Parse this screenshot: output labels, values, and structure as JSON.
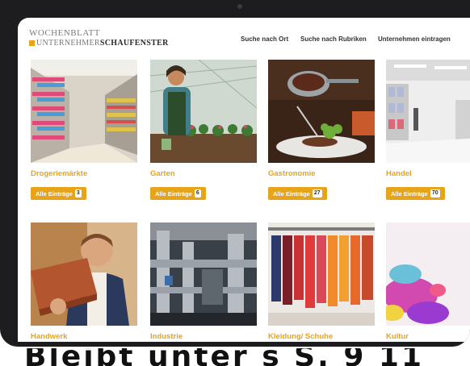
{
  "header": {
    "logo_line1": "WOCHENBLATT",
    "logo_line2_a": "UNTERNEHMER",
    "logo_line2_b": "SCHAUFENSTER",
    "nav": [
      "Suche nach Ort",
      "Suche nach Rubriken",
      "Unternehmen eintragen"
    ]
  },
  "categories": [
    {
      "label": "Drogeriemärkte",
      "button": "Alle Einträge",
      "count": "3"
    },
    {
      "label": "Garten",
      "button": "Alle Einträge",
      "count": "6"
    },
    {
      "label": "Gastronomie",
      "button": "Alle Einträge",
      "count": "27"
    },
    {
      "label": "Handel",
      "button": "Alle Einträge",
      "count": "70"
    },
    {
      "label": "Handwerk"
    },
    {
      "label": "Industrie"
    },
    {
      "label": "Kleidung/ Schuhe"
    },
    {
      "label": "Kultur"
    }
  ],
  "accent_color": "#e8a419",
  "caption": "Bleibt unter s S. 9 11"
}
